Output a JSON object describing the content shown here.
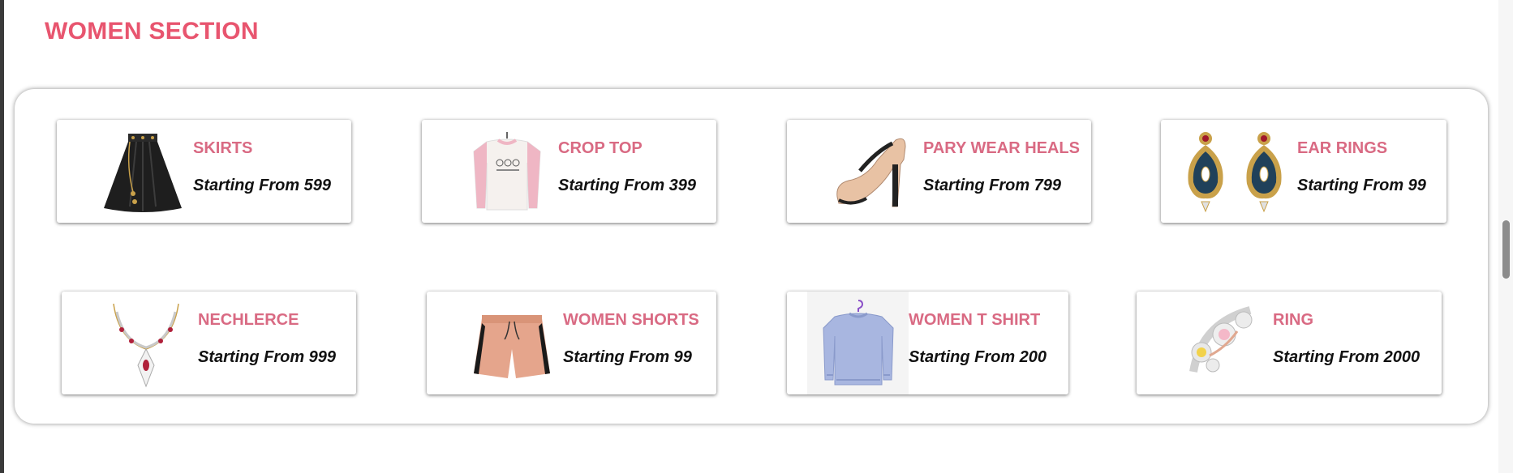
{
  "section": {
    "title": "WOMEN SECTION"
  },
  "products": [
    {
      "name": "SKIRTS",
      "price": "Starting From 599",
      "icon": "skirt-image"
    },
    {
      "name": "CROP TOP",
      "price": "Starting From 399",
      "icon": "sweatshirt-image"
    },
    {
      "name": "PARY WEAR HEALS",
      "price": "Starting From 799",
      "icon": "high-heel-image"
    },
    {
      "name": "EAR RINGS",
      "price": "Starting From 99",
      "icon": "earrings-image"
    },
    {
      "name": "NECHLERCE",
      "price": "Starting From 999",
      "icon": "necklace-image"
    },
    {
      "name": "WOMEN SHORTS",
      "price": "Starting From 99",
      "icon": "shorts-image"
    },
    {
      "name": "WOMEN T SHIRT",
      "price": "Starting From 200",
      "icon": "tshirt-image"
    },
    {
      "name": "RING",
      "price": "Starting From 2000",
      "icon": "ring-image"
    }
  ],
  "colors": {
    "title": "#e8556f",
    "product_name": "#d96a83",
    "price": "#111111"
  }
}
